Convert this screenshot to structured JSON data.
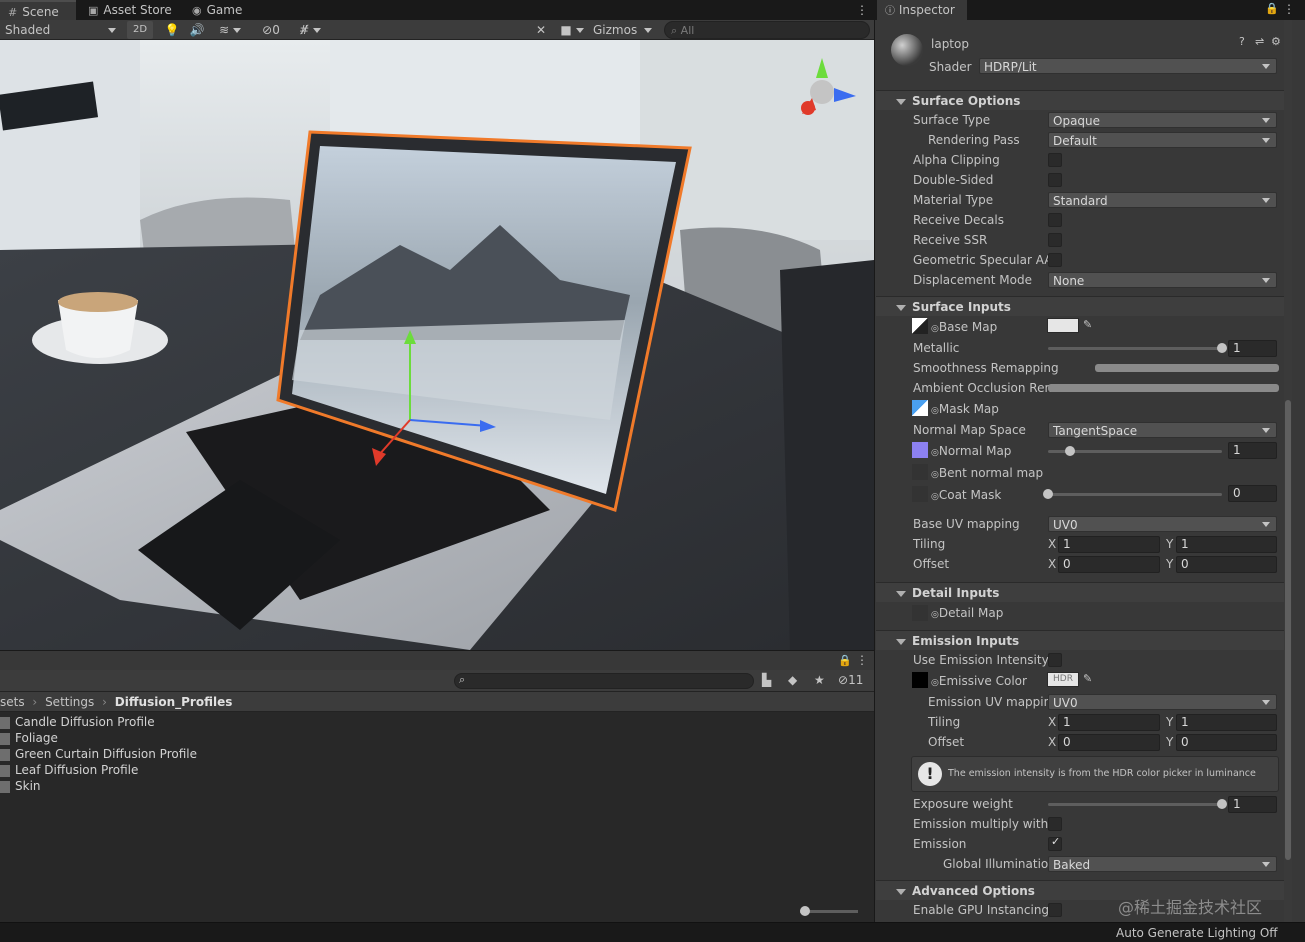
{
  "tabs": {
    "scene": "Scene",
    "asset_store": "Asset Store",
    "game": "Game"
  },
  "scene_toolbar": {
    "shading_mode": "Shaded",
    "mode_2d": "2D",
    "hidden_count": "0",
    "gizmos": "Gizmos",
    "search_placeholder": "All"
  },
  "project": {
    "breadcrumb": [
      "sets",
      "Settings",
      "Diffusion_Profiles"
    ],
    "hidden_count": "11",
    "items": [
      "Candle Diffusion Profile",
      "Foliage",
      "Green Curtain Diffusion Profile",
      "Leaf Diffusion Profile",
      "Skin"
    ]
  },
  "status": {
    "lighting": "Auto Generate Lighting Off"
  },
  "watermark": "@稀土掘金技术社区",
  "inspector": {
    "tab": "Inspector",
    "material_name": "laptop",
    "shader_label": "Shader",
    "shader_value": "HDRP/Lit",
    "surface_options": {
      "title": "Surface Options",
      "surface_type_label": "Surface Type",
      "surface_type": "Opaque",
      "rendering_pass_label": "Rendering Pass",
      "rendering_pass": "Default",
      "alpha_clipping": "Alpha Clipping",
      "double_sided": "Double-Sided",
      "material_type_label": "Material Type",
      "material_type": "Standard",
      "receive_decals": "Receive Decals",
      "receive_ssr": "Receive SSR",
      "geometric_specular_aa": "Geometric Specular AA",
      "displacement_mode_label": "Displacement Mode",
      "displacement_mode": "None"
    },
    "surface_inputs": {
      "title": "Surface Inputs",
      "base_map": "Base Map",
      "metallic_label": "Metallic",
      "metallic": "1",
      "metallic_fraction": 1.0,
      "smoothness_remapping": "Smoothness Remapping",
      "ao_remapping": "Ambient Occlusion Rem",
      "mask_map": "Mask Map",
      "normal_map_space_label": "Normal Map Space",
      "normal_map_space": "TangentSpace",
      "normal_map": "Normal Map",
      "normal_map_value": "1",
      "normal_map_fraction": 0.125,
      "bent_normal_map": "Bent normal map",
      "coat_mask": "Coat Mask",
      "coat_mask_value": "0",
      "coat_mask_fraction": 0.0,
      "base_uv_mapping_label": "Base UV mapping",
      "base_uv_mapping": "UV0",
      "tiling_label": "Tiling",
      "tiling_x": "1",
      "tiling_y": "1",
      "offset_label": "Offset",
      "offset_x": "0",
      "offset_y": "0"
    },
    "detail_inputs": {
      "title": "Detail Inputs",
      "detail_map": "Detail Map"
    },
    "emission_inputs": {
      "title": "Emission Inputs",
      "use_emission_intensity": "Use Emission Intensity",
      "emissive_color": "Emissive Color",
      "hdr_badge": "HDR",
      "emission_uv_mapping_label": "Emission UV mapping",
      "emission_uv_mapping": "UV0",
      "tiling_label": "Tiling",
      "tiling_x": "1",
      "tiling_y": "1",
      "offset_label": "Offset",
      "offset_x": "0",
      "offset_y": "0",
      "help_text": "The emission intensity is from the HDR color picker in luminance",
      "exposure_weight_label": "Exposure weight",
      "exposure_weight": "1",
      "exposure_weight_fraction": 1.0,
      "emission_multiply": "Emission multiply with B",
      "emission_label": "Emission",
      "global_illumination_label": "Global Illumination",
      "global_illumination": "Baked"
    },
    "advanced_options": {
      "title": "Advanced Options",
      "enable_gpu_instancing": "Enable GPU Instancing"
    }
  },
  "colors": {
    "selection_outline": "#f07a2a",
    "axis_y": "#6cdc3c",
    "axis_x": "#e03a2a",
    "axis_z": "#3a6cf0",
    "normal_map_swatch": "#8c80f0"
  }
}
